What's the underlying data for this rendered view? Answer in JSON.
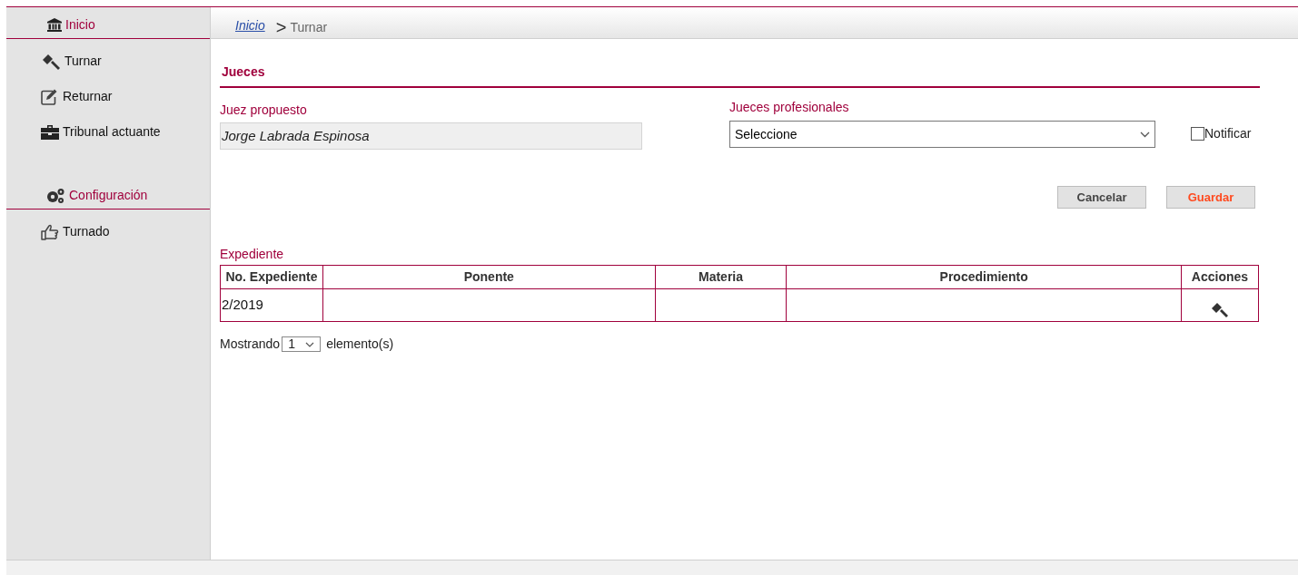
{
  "sidebar": {
    "items": [
      {
        "kind": "header",
        "label": "Inicio"
      },
      {
        "kind": "item",
        "label": "Turnar"
      },
      {
        "kind": "item",
        "label": "Returnar"
      },
      {
        "kind": "item",
        "label": "Tribunal actuante"
      },
      {
        "kind": "header",
        "label": "Configuración"
      },
      {
        "kind": "item",
        "label": "Turnado"
      }
    ]
  },
  "breadcrumb": {
    "link": "Inicio",
    "separator": ">",
    "current": "Turnar"
  },
  "section_title": "Jueces",
  "form": {
    "juez_propuesto": {
      "label": "Juez propuesto",
      "value": "Jorge Labrada Espinosa"
    },
    "jueces_profesionales": {
      "label": "Jueces profesionales",
      "value": "Seleccione"
    },
    "notificar": {
      "label": "Notificar",
      "checked": false
    }
  },
  "buttons": [
    {
      "label": "Cancelar",
      "kind": "normal"
    },
    {
      "label": "Guardar",
      "kind": "primary"
    }
  ],
  "table": {
    "title": "Expediente",
    "columns": [
      "No. Expediente",
      "Ponente",
      "Materia",
      "Procedimiento",
      "Acciones"
    ],
    "rows": [
      {
        "cells": [
          "2/2019",
          "",
          "",
          ""
        ]
      }
    ]
  },
  "pager": {
    "prefix": "Mostrando",
    "value": "1",
    "suffix": "elemento(s)"
  }
}
